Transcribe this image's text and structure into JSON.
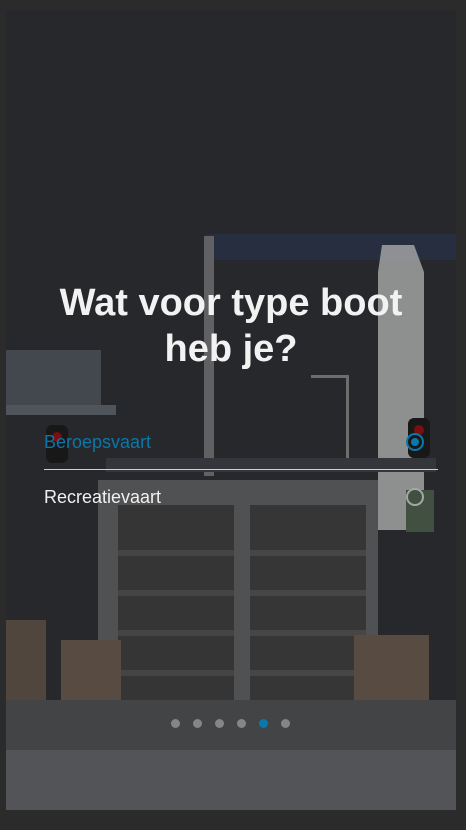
{
  "question": {
    "title_line1": "Wat voor type boot",
    "title_line2": "heb je?"
  },
  "options": [
    {
      "label": "Beroepsvaart",
      "selected": true
    },
    {
      "label": "Recreatievaart",
      "selected": false
    }
  ],
  "pager": {
    "total": 6,
    "active_index": 5
  },
  "colors": {
    "accent": "#0b78ab",
    "title": "#f2f2f2"
  }
}
